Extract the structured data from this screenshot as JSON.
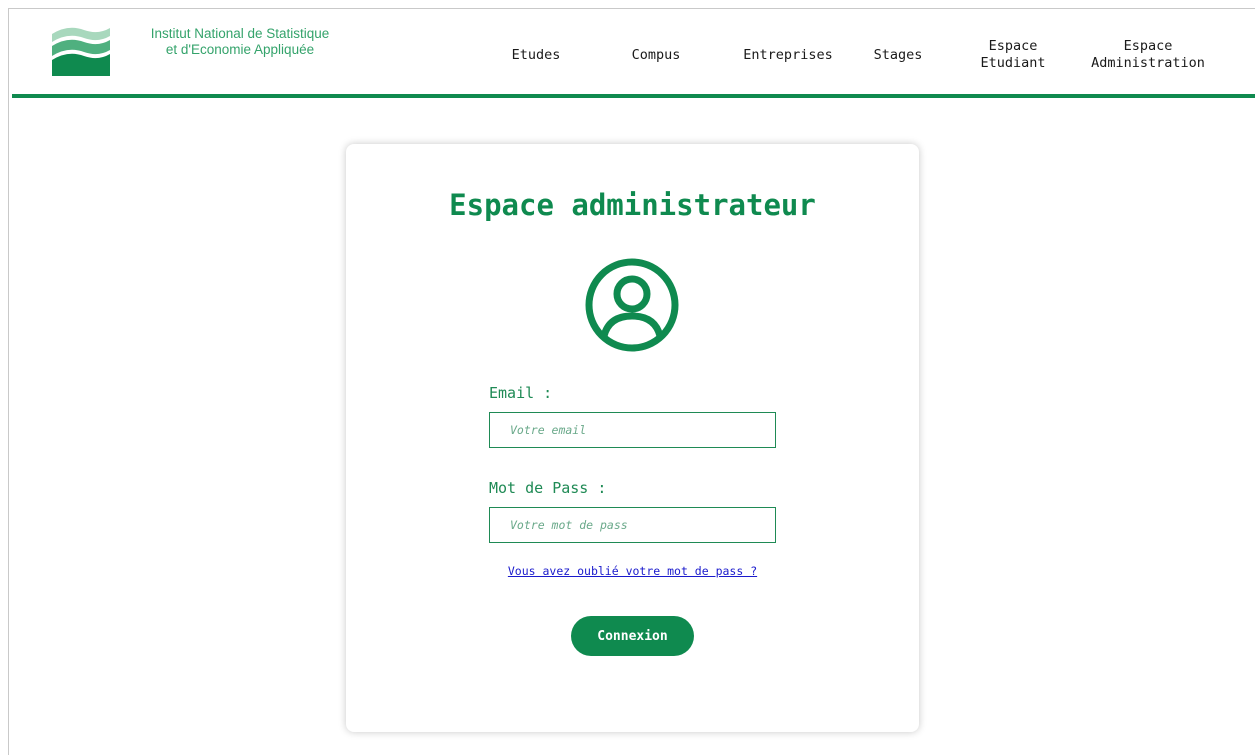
{
  "colors": {
    "primary": "#0f8a4f",
    "label": "#1f8a55",
    "link": "#1a1acc"
  },
  "brand": {
    "line1": "Institut National de Statistique",
    "line2": "et d'Economie Appliquée",
    "logo_icon": "inseea-waves-logo"
  },
  "nav": [
    {
      "label": "Etudes"
    },
    {
      "label": "Compus"
    },
    {
      "label": "Entreprises"
    },
    {
      "label": "Stages"
    },
    {
      "line1": "Espace",
      "line2": "Etudiant"
    },
    {
      "line1": "Espace",
      "line2": "Administration"
    }
  ],
  "login": {
    "title": "Espace administrateur",
    "icon": "user-circle-icon",
    "email_label": "Email :",
    "email_placeholder": "Votre email",
    "password_label": "Mot de Pass :",
    "password_placeholder": "Votre mot de pass",
    "forgot_link": "Vous avez oublié votre mot de pass ?",
    "submit_label": "Connexion"
  }
}
